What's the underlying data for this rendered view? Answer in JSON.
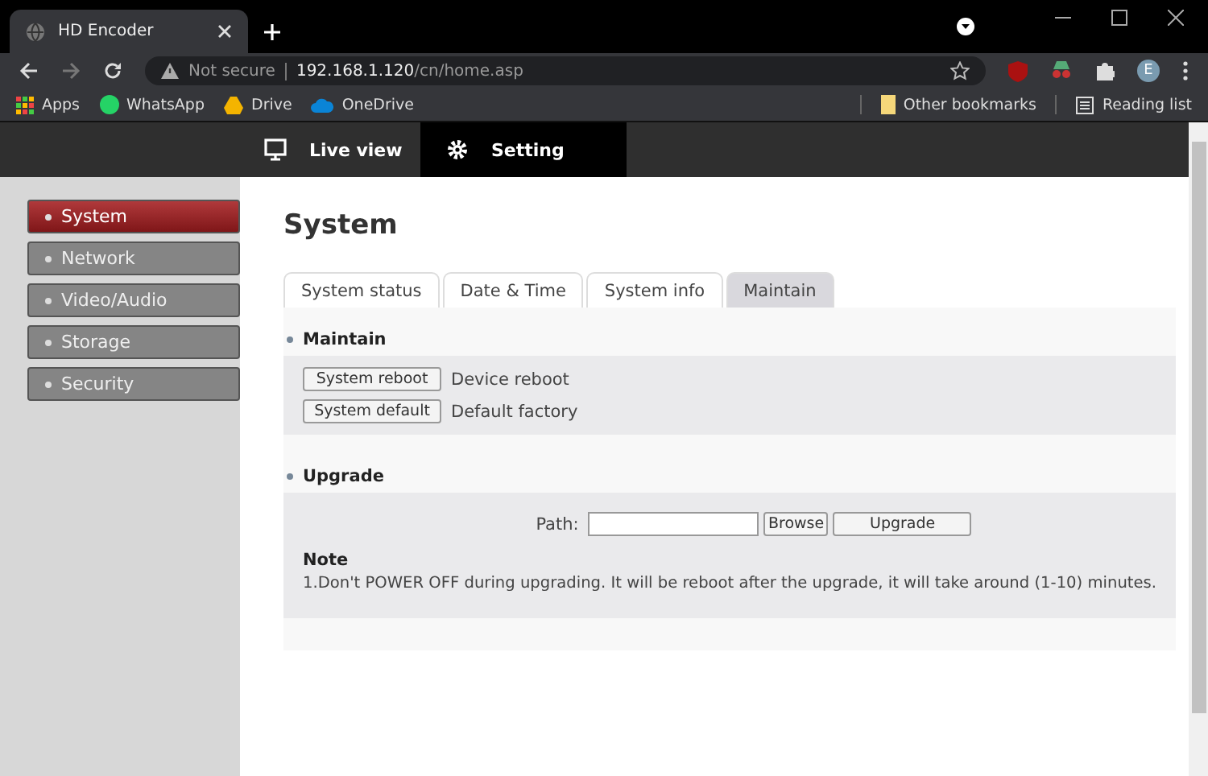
{
  "browser": {
    "tab_title": "HD Encoder",
    "security": "Not secure",
    "url_host": "192.168.1.120",
    "url_path": "/cn/home.asp",
    "avatar": "E",
    "bookmarks": [
      {
        "label": "Apps",
        "kind": "apps"
      },
      {
        "label": "WhatsApp",
        "kind": "whatsapp"
      },
      {
        "label": "Drive",
        "kind": "drive"
      },
      {
        "label": "OneDrive",
        "kind": "onedrive"
      }
    ],
    "other_bookmarks": "Other bookmarks",
    "reading_list": "Reading list"
  },
  "nav": [
    {
      "label": "Live view",
      "kind": "monitor",
      "selected": false
    },
    {
      "label": "Setting",
      "kind": "gear",
      "selected": true
    }
  ],
  "sidebar": [
    {
      "label": "System",
      "selected": true
    },
    {
      "label": "Network",
      "selected": false
    },
    {
      "label": "Video/Audio",
      "selected": false
    },
    {
      "label": "Storage",
      "selected": false
    },
    {
      "label": "Security",
      "selected": false
    }
  ],
  "page_title": "System",
  "tabs": [
    {
      "label": "System status",
      "selected": false
    },
    {
      "label": "Date & Time",
      "selected": false
    },
    {
      "label": "System info",
      "selected": false
    },
    {
      "label": "Maintain",
      "selected": true
    }
  ],
  "maintain": {
    "title": "Maintain",
    "rows": [
      {
        "button": "System reboot",
        "description": "Device reboot"
      },
      {
        "button": "System default",
        "description": "Default factory"
      }
    ]
  },
  "upgrade": {
    "title": "Upgrade",
    "path_label": "Path:",
    "browse": "Browse",
    "upgrade": "Upgrade",
    "note_title": "Note",
    "note": "1.Don't POWER OFF during upgrading. It will be reboot after the upgrade, it will take around (1-10) minutes."
  }
}
